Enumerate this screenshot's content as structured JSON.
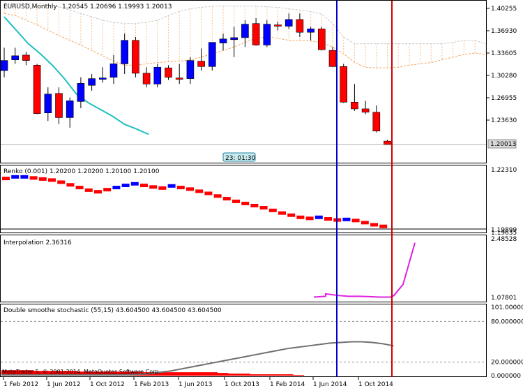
{
  "colors": {
    "bull": "#0000ff",
    "bear": "#ff0000",
    "cloud": "#f4a460",
    "cyan_line": "#20c0c0",
    "interp_line": "#e020e0",
    "stoch_line": "#707070",
    "stoch_fill": "#ff0000",
    "vline_blue": "#0000cc",
    "vline_red": "#cc0000",
    "time_label_bg": "#c8ecf0"
  },
  "main": {
    "title": "EURUSD,Monthly",
    "ohlc": "1.20545 1.20696 1.19993 1.20013",
    "price_labels": [
      "1.40255",
      "1.36930",
      "1.33605",
      "1.30280",
      "1.26955",
      "1.23630"
    ],
    "last_price": "1.20013",
    "time_label": "23: 01:30",
    "candles": [
      {
        "o": 1.31,
        "h": 1.344,
        "l": 1.3,
        "c": 1.325
      },
      {
        "o": 1.326,
        "h": 1.344,
        "l": 1.32,
        "c": 1.332
      },
      {
        "o": 1.333,
        "h": 1.338,
        "l": 1.318,
        "c": 1.325
      },
      {
        "o": 1.318,
        "h": 1.32,
        "l": 1.245,
        "c": 1.246
      },
      {
        "o": 1.247,
        "h": 1.285,
        "l": 1.235,
        "c": 1.275
      },
      {
        "o": 1.276,
        "h": 1.285,
        "l": 1.23,
        "c": 1.24
      },
      {
        "o": 1.24,
        "h": 1.27,
        "l": 1.225,
        "c": 1.265
      },
      {
        "o": 1.264,
        "h": 1.3,
        "l": 1.254,
        "c": 1.291
      },
      {
        "o": 1.288,
        "h": 1.305,
        "l": 1.28,
        "c": 1.298
      },
      {
        "o": 1.297,
        "h": 1.315,
        "l": 1.292,
        "c": 1.299
      },
      {
        "o": 1.3,
        "h": 1.333,
        "l": 1.29,
        "c": 1.32
      },
      {
        "o": 1.32,
        "h": 1.365,
        "l": 1.305,
        "c": 1.355
      },
      {
        "o": 1.355,
        "h": 1.36,
        "l": 1.3,
        "c": 1.306
      },
      {
        "o": 1.306,
        "h": 1.315,
        "l": 1.285,
        "c": 1.29
      },
      {
        "o": 1.29,
        "h": 1.32,
        "l": 1.285,
        "c": 1.315
      },
      {
        "o": 1.314,
        "h": 1.318,
        "l": 1.296,
        "c": 1.3
      },
      {
        "o": 1.299,
        "h": 1.32,
        "l": 1.29,
        "c": 1.297
      },
      {
        "o": 1.298,
        "h": 1.33,
        "l": 1.29,
        "c": 1.325
      },
      {
        "o": 1.324,
        "h": 1.343,
        "l": 1.31,
        "c": 1.316
      },
      {
        "o": 1.316,
        "h": 1.352,
        "l": 1.31,
        "c": 1.352
      },
      {
        "o": 1.351,
        "h": 1.365,
        "l": 1.34,
        "c": 1.357
      },
      {
        "o": 1.356,
        "h": 1.375,
        "l": 1.33,
        "c": 1.359
      },
      {
        "o": 1.359,
        "h": 1.385,
        "l": 1.345,
        "c": 1.379
      },
      {
        "o": 1.38,
        "h": 1.388,
        "l": 1.347,
        "c": 1.348
      },
      {
        "o": 1.348,
        "h": 1.385,
        "l": 1.345,
        "c": 1.379
      },
      {
        "o": 1.378,
        "h": 1.383,
        "l": 1.37,
        "c": 1.376
      },
      {
        "o": 1.376,
        "h": 1.395,
        "l": 1.372,
        "c": 1.386
      },
      {
        "o": 1.386,
        "h": 1.395,
        "l": 1.36,
        "c": 1.367
      },
      {
        "o": 1.367,
        "h": 1.375,
        "l": 1.355,
        "c": 1.372
      },
      {
        "o": 1.372,
        "h": 1.375,
        "l": 1.34,
        "c": 1.341
      },
      {
        "o": 1.34,
        "h": 1.345,
        "l": 1.315,
        "c": 1.316
      },
      {
        "o": 1.316,
        "h": 1.32,
        "l": 1.262,
        "c": 1.263
      },
      {
        "o": 1.263,
        "h": 1.29,
        "l": 1.25,
        "c": 1.253
      },
      {
        "o": 1.253,
        "h": 1.265,
        "l": 1.245,
        "c": 1.248
      },
      {
        "o": 1.248,
        "h": 1.258,
        "l": 1.218,
        "c": 1.22
      },
      {
        "o": 1.205,
        "h": 1.207,
        "l": 1.2,
        "c": 1.2
      }
    ],
    "cloud_top": [
      1.41,
      1.41,
      1.41,
      1.41,
      1.408,
      1.405,
      1.4,
      1.395,
      1.39,
      1.385,
      1.382,
      1.38,
      1.38,
      1.382,
      1.385,
      1.392,
      1.398,
      1.402,
      1.404,
      1.406,
      1.406,
      1.406,
      1.406,
      1.406,
      1.405,
      1.404,
      1.402,
      1.4,
      1.398,
      1.394,
      1.38,
      1.36,
      1.35,
      1.35,
      1.35,
      1.35,
      1.35,
      1.35,
      1.35,
      1.35,
      1.35,
      1.352,
      1.355,
      1.355,
      1.35
    ],
    "cloud_bottom": [
      1.395,
      1.392,
      1.385,
      1.378,
      1.37,
      1.362,
      1.355,
      1.348,
      1.34,
      1.332,
      1.324,
      1.318,
      1.318,
      1.32,
      1.322,
      1.323,
      1.324,
      1.326,
      1.33,
      1.335,
      1.34,
      1.345,
      1.352,
      1.358,
      1.36,
      1.358,
      1.355,
      1.355,
      1.354,
      1.352,
      1.345,
      1.335,
      1.322,
      1.315,
      1.314,
      1.314,
      1.315,
      1.318,
      1.32,
      1.322,
      1.326,
      1.33,
      1.334,
      1.336,
      1.334
    ],
    "cyan_line": [
      1.39,
      1.37,
      1.35,
      1.335,
      1.318,
      1.298,
      1.275,
      1.262,
      1.252,
      1.242,
      1.23,
      1.223,
      1.215
    ]
  },
  "renko": {
    "label": "Renko (0.001) 1.20200 1.20200 1.20100 1.20100",
    "price_labels": [
      "1.22310",
      "1.19899",
      "1.19635"
    ],
    "bricks": [
      {
        "v": 1.2215,
        "d": "bear"
      },
      {
        "v": 1.2218,
        "d": "bull"
      },
      {
        "v": 1.2218,
        "d": "bull"
      },
      {
        "v": 1.2216,
        "d": "bear"
      },
      {
        "v": 1.2214,
        "d": "bear"
      },
      {
        "v": 1.2212,
        "d": "bear"
      },
      {
        "v": 1.2208,
        "d": "bear"
      },
      {
        "v": 1.2203,
        "d": "bear"
      },
      {
        "v": 1.2198,
        "d": "bear"
      },
      {
        "v": 1.2193,
        "d": "bear"
      },
      {
        "v": 1.219,
        "d": "bear"
      },
      {
        "v": 1.2194,
        "d": "bear"
      },
      {
        "v": 1.2198,
        "d": "bull"
      },
      {
        "v": 1.2202,
        "d": "bull"
      },
      {
        "v": 1.2205,
        "d": "bull"
      },
      {
        "v": 1.2202,
        "d": "bear"
      },
      {
        "v": 1.2199,
        "d": "bear"
      },
      {
        "v": 1.2197,
        "d": "bear"
      },
      {
        "v": 1.2201,
        "d": "bull"
      },
      {
        "v": 1.2198,
        "d": "bear"
      },
      {
        "v": 1.2195,
        "d": "bear"
      },
      {
        "v": 1.2191,
        "d": "bear"
      },
      {
        "v": 1.2187,
        "d": "bear"
      },
      {
        "v": 1.2182,
        "d": "bear"
      },
      {
        "v": 1.2177,
        "d": "bear"
      },
      {
        "v": 1.2172,
        "d": "bear"
      },
      {
        "v": 1.2168,
        "d": "bear"
      },
      {
        "v": 1.2164,
        "d": "bear"
      },
      {
        "v": 1.216,
        "d": "bear"
      },
      {
        "v": 1.2155,
        "d": "bear"
      },
      {
        "v": 1.215,
        "d": "bear"
      },
      {
        "v": 1.2146,
        "d": "bear"
      },
      {
        "v": 1.2142,
        "d": "bear"
      },
      {
        "v": 1.214,
        "d": "bear"
      },
      {
        "v": 1.2142,
        "d": "bull"
      },
      {
        "v": 1.2139,
        "d": "bear"
      },
      {
        "v": 1.2137,
        "d": "bear"
      },
      {
        "v": 1.2138,
        "d": "bull"
      },
      {
        "v": 1.2136,
        "d": "bear"
      },
      {
        "v": 1.2132,
        "d": "bear"
      },
      {
        "v": 1.2128,
        "d": "bear"
      },
      {
        "v": 1.2125,
        "d": "bear"
      }
    ]
  },
  "interp": {
    "label": "Interpolation 2.36316",
    "price_labels": [
      "2.48528",
      "1.07801"
    ],
    "values": [
      1.08,
      1.1,
      1.16,
      1.12,
      1.1,
      1.1,
      1.09,
      1.08,
      1.08,
      1.12,
      1.4,
      2.45
    ]
  },
  "stoch": {
    "label": "Double smoothe stochastic (55,15) 43.604500 43.604500 43.604500",
    "price_labels": [
      "101.000000",
      "80.000000",
      "20.000000",
      "0.000000"
    ],
    "levels": [
      80,
      20
    ],
    "values": [
      1,
      1,
      1,
      1,
      1,
      1,
      1,
      1,
      1,
      1,
      1,
      1,
      1,
      2,
      3,
      5,
      7,
      10,
      13,
      16,
      19,
      22,
      25,
      28,
      31,
      34,
      37,
      40,
      42,
      44,
      46,
      48,
      49,
      50,
      50,
      49,
      47,
      44
    ],
    "fill_bars": [
      8,
      8,
      8,
      7,
      7,
      7,
      7,
      6,
      6,
      6,
      6,
      6,
      6,
      5,
      5,
      5,
      5,
      5,
      5,
      5,
      4,
      3,
      3,
      2,
      2,
      2,
      2,
      1,
      0,
      0,
      0,
      0,
      0,
      0,
      0,
      0,
      0,
      0
    ],
    "watermark": "MetaTrader 5, © 2001-2014, MetaQuotes Software Corp."
  },
  "xaxis": {
    "labels": [
      "1 Feb 2012",
      "1 Jun 2012",
      "1 Oct 2012",
      "1 Feb 2013",
      "1 Jun 2013",
      "1 Oct 2013",
      "1 Feb 2014",
      "1 Jun 2014",
      "1 Oct 2014"
    ]
  }
}
